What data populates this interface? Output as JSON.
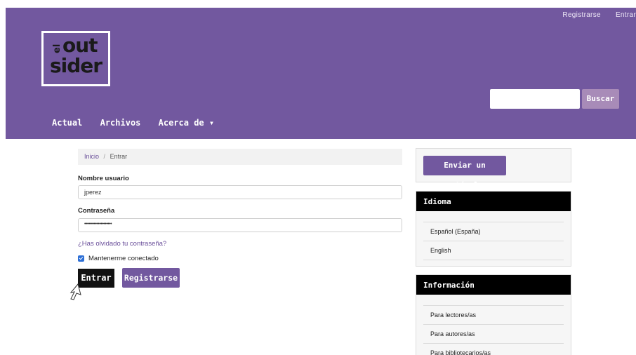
{
  "header": {
    "top_links": [
      "Registrarse",
      "Entrar"
    ],
    "logo": {
      "prefix": "el",
      "line1": "out",
      "line2": "sider"
    },
    "nav": [
      "Actual",
      "Archivos",
      "Acerca de ▾"
    ],
    "search": {
      "placeholder": "",
      "button": "Buscar"
    }
  },
  "breadcrumb": {
    "home": "Inicio",
    "separator": "/",
    "current": "Entrar"
  },
  "form": {
    "username_label": "Nombre usuario",
    "username_value": "jperez",
    "password_label": "Contraseña",
    "password_value": "••••••••••••••••••••",
    "forgot": "¿Has olvidado tu contraseña?",
    "remember": "Mantenerme conectado",
    "login_button": "Entrar",
    "register_button": "Registrarse"
  },
  "sidebar": {
    "submit_button": "Enviar un artículo",
    "language": {
      "title": "Idioma",
      "items": [
        "Español (España)",
        "English"
      ]
    },
    "info": {
      "title": "Información",
      "items": [
        "Para lectores/as",
        "Para autores/as",
        "Para bibliotecarios/as"
      ]
    }
  },
  "colors": {
    "brand": "#72589f",
    "dark": "#000000",
    "link": "#6a4f9a"
  }
}
